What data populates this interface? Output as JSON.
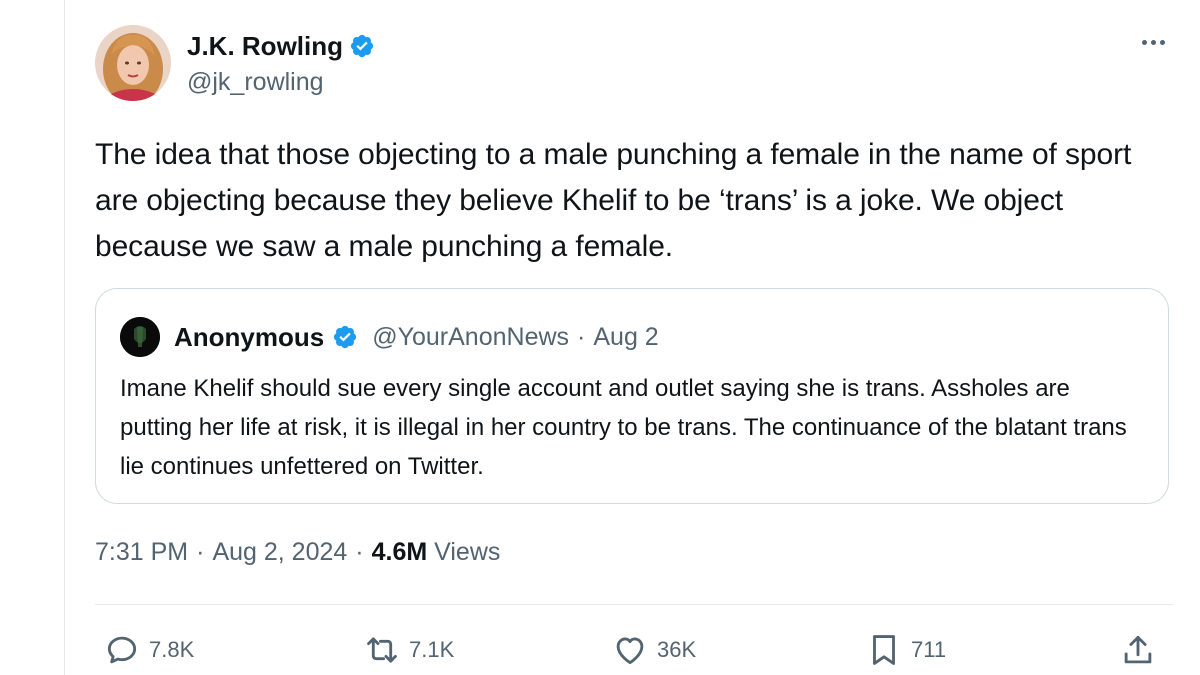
{
  "tweet": {
    "author": {
      "name": "J.K. Rowling",
      "handle": "@jk_rowling",
      "verified": true
    },
    "text": "The idea that those objecting to a male punching a female in the name of sport are objecting because they believe Khelif to be ‘trans’ is a joke. We object because we saw a male punching a female.",
    "more_icon": "more-horizontal-icon"
  },
  "quote": {
    "author": {
      "name": "Anonymous",
      "handle": "@YourAnonNews",
      "verified": true
    },
    "separator": "·",
    "date": "Aug 2",
    "text": "Imane Khelif should sue every single account and outlet saying she is trans. Assholes are putting her life at risk, it is illegal in her country to be trans. The continuance of the blatant trans lie continues unfettered on Twitter."
  },
  "meta": {
    "time": "7:31 PM",
    "separator": "·",
    "date": "Aug 2, 2024",
    "views_count": "4.6M",
    "views_label": "Views"
  },
  "actions": {
    "replies": "7.8K",
    "reposts": "7.1K",
    "likes": "36K",
    "bookmarks": "711"
  },
  "colors": {
    "verified_blue": "#1d9bf0",
    "secondary_text": "#536471",
    "border": "#cfd9de"
  }
}
